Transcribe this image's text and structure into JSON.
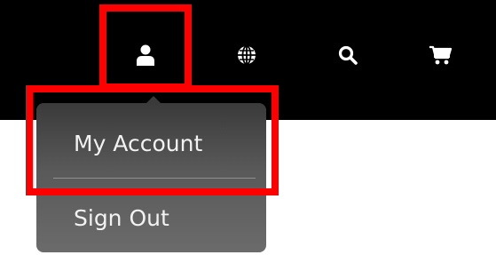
{
  "nav": {
    "icons": [
      {
        "icon": "user-icon"
      },
      {
        "icon": "globe-icon"
      },
      {
        "icon": "search-icon"
      },
      {
        "icon": "cart-icon"
      }
    ]
  },
  "dropdown": {
    "items": [
      {
        "label": "My Account"
      },
      {
        "label": "Sign Out"
      }
    ]
  },
  "colors": {
    "topbar_bg": "#000000",
    "highlight": "#ff0000",
    "menu_bg": "#595959",
    "menu_text": "#f2f2f2"
  }
}
